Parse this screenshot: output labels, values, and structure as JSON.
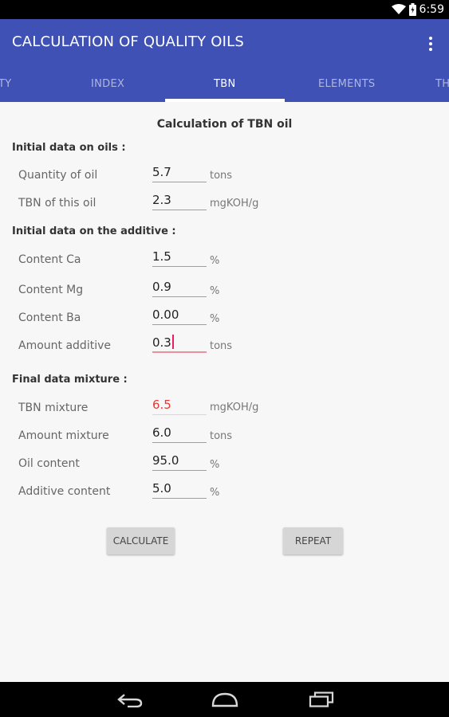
{
  "status": {
    "time": "6:59"
  },
  "app": {
    "title": "CALCULATION OF QUALITY OILS"
  },
  "tabs": [
    "TY",
    "INDEX",
    "TBN",
    "ELEMENTS",
    "TH"
  ],
  "form": {
    "title": "Calculation of TBN oil",
    "oils_section": "Initial data on oils :",
    "quantity_label": "Quantity of oil",
    "quantity_value": "5.7",
    "quantity_unit": "tons",
    "tbn_label": "TBN of this oil",
    "tbn_value": "2.3",
    "tbn_unit": "mgKOH/g",
    "additive_section": "Initial data on the additive :",
    "ca_label": "Content Ca",
    "ca_value": "1.5",
    "ca_unit": "%",
    "mg_label": "Content Mg",
    "mg_value": "0.9",
    "mg_unit": "%",
    "ba_label": "Content Ba",
    "ba_value": "0.00",
    "ba_unit": "%",
    "amount_add_label": "Amount additive",
    "amount_add_value": "0.3",
    "amount_add_unit": "tons",
    "final_section": "Final data mixture :",
    "tbn_mix_label": "TBN mixture",
    "tbn_mix_value": "6.5",
    "tbn_mix_unit": "mgKOH/g",
    "amount_mix_label": "Amount mixture",
    "amount_mix_value": "6.0",
    "amount_mix_unit": "tons",
    "oil_content_label": "Oil content",
    "oil_content_value": "95.0",
    "oil_content_unit": "%",
    "add_content_label": "Additive content",
    "add_content_value": "5.0",
    "add_content_unit": "%"
  },
  "buttons": {
    "calculate": "CALCULATE",
    "repeat": "REPEAT"
  },
  "colors": {
    "app_bar": "#3f51b5",
    "result_red": "#e53935",
    "focus_pink": "#e91e63"
  }
}
